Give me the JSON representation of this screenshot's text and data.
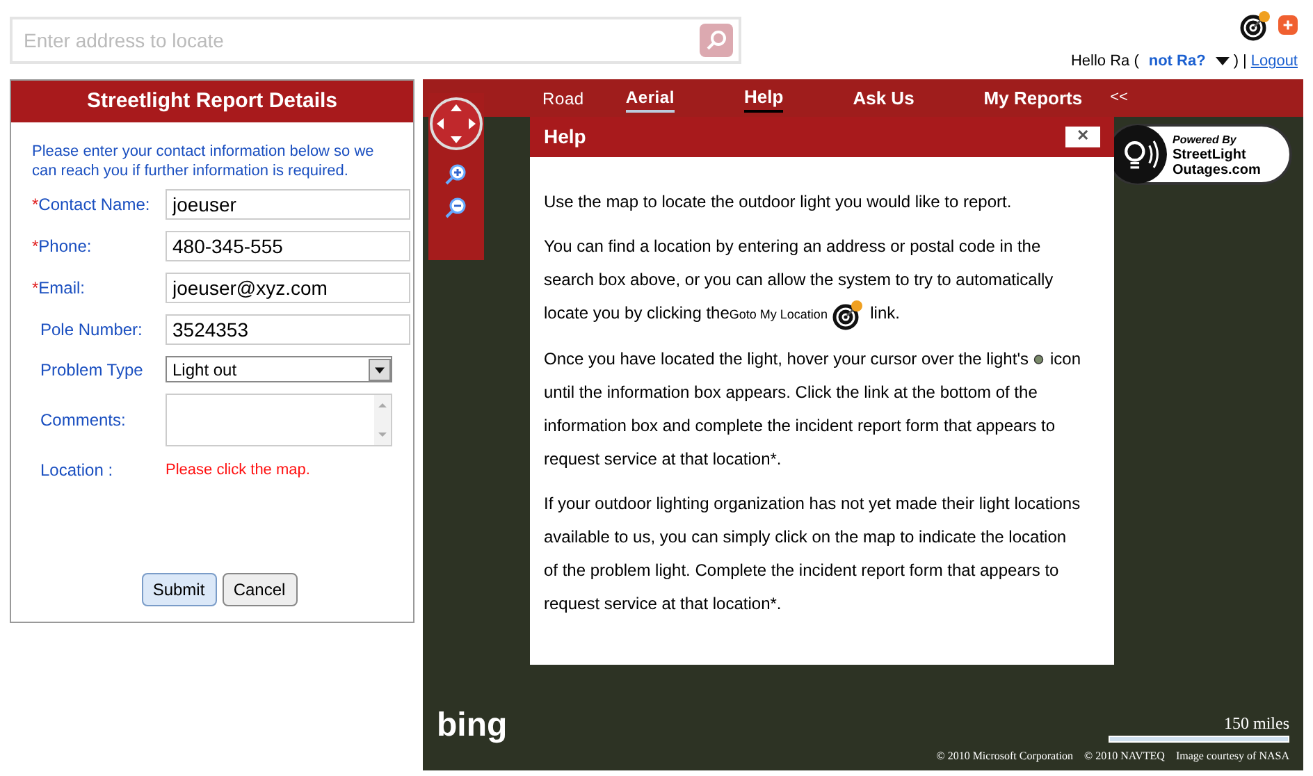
{
  "search": {
    "placeholder": "Enter address to locate"
  },
  "user": {
    "greeting": "Hello Ra (",
    "not_me": "not Ra?",
    "close_paren": ")",
    "separator": "|",
    "logout": "Logout"
  },
  "form": {
    "title": "Streetlight Report Details",
    "intro": "Please enter your contact information below so we can reach you if further information is required.",
    "fields": [
      {
        "kind": "text",
        "label": "Contact Name:",
        "required": true,
        "value": "joeuser"
      },
      {
        "kind": "text",
        "label": "Phone:",
        "required": true,
        "value": "480-345-555"
      },
      {
        "kind": "text",
        "label": "Email:",
        "required": true,
        "value": "joeuser@xyz.com"
      },
      {
        "kind": "text",
        "label": "Pole Number:",
        "required": false,
        "value": "3524353"
      },
      {
        "kind": "select",
        "label": "Problem Type",
        "required": false,
        "value": "Light out"
      },
      {
        "kind": "textarea",
        "label": "Comments:",
        "required": false
      },
      {
        "kind": "message",
        "label": "Location :",
        "required": false,
        "value": "Please click the map."
      }
    ],
    "required_mark": "*",
    "buttons": [
      {
        "label": "Submit",
        "primary": true
      },
      {
        "label": "Cancel",
        "primary": false
      }
    ]
  },
  "map": {
    "styles": [
      {
        "label": "Road",
        "selected": false
      },
      {
        "label": "Aerial",
        "selected": true
      }
    ],
    "menu": [
      {
        "label": "Help",
        "selected": true
      },
      {
        "label": "Ask Us",
        "selected": false
      },
      {
        "label": "My Reports",
        "selected": false
      }
    ],
    "collapse": "<<",
    "brand": "bing",
    "scale": "150 miles",
    "copyright": "© 2010 Microsoft Corporation    © 2010 NAVTEQ    Image courtesy of NASA",
    "logo": {
      "top": "Powered By",
      "bottom": "StreetLight Outages.com"
    }
  },
  "help": {
    "title": "Help",
    "close": "✕",
    "paragraphs": [
      "Use the map to locate the outdoor light you would like to report.",
      "You can find a location by entering an address or postal code in the search box above, or you can allow the system to try to automatically locate you by clicking the",
      "Once you have located the light, hover your cursor over the light's",
      "If your outdoor lighting organization has not yet made their light locations available to us, you can simply click on the map to indicate the location of the problem light. Complete the incident report form that appears to request service at that location*."
    ],
    "goto_link": "Goto My Location",
    "after_link": "link.",
    "icon_word": "icon",
    "icon_text": "until the information box appears. Click the link at the bottom of the information box and complete the incident report form that appears to request service at that location*."
  }
}
